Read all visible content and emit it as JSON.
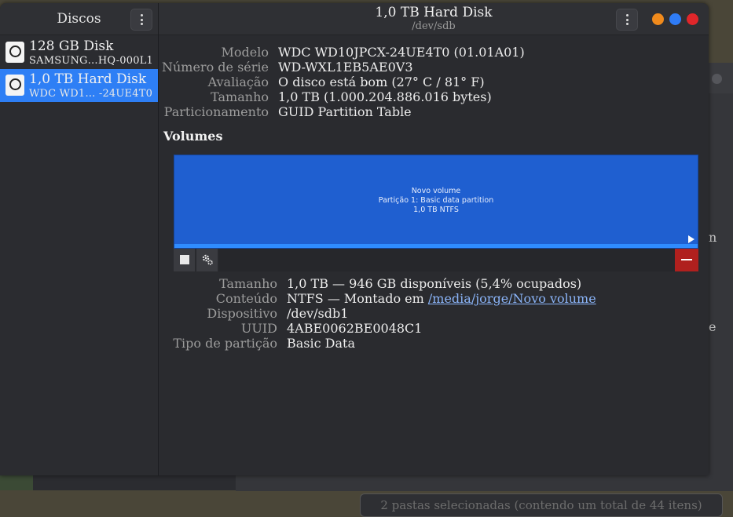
{
  "background": {
    "status_text": "2 pastas selecionadas (contendo um total de 44 itens)",
    "edge_chars": [
      "n",
      "e"
    ]
  },
  "sidebar": {
    "title": "Discos",
    "disks": [
      {
        "name": "128 GB Disk",
        "subtitle": "SAMSUNG…HQ-000L1",
        "selected": false
      },
      {
        "name": "1,0 TB Hard Disk",
        "subtitle": "WDC WD1…  -24UE4T0",
        "selected": true
      }
    ]
  },
  "window": {
    "title": "1,0 TB Hard Disk",
    "subtitle": "/dev/sdb",
    "controls": {
      "minimize_color": "#f08a1c",
      "maximize_color": "#2f7cf6",
      "close_color": "#e0262a"
    }
  },
  "drive_info": [
    {
      "label": "Modelo",
      "value": "WDC WD10JPCX-24UE4T0 (01.01A01)"
    },
    {
      "label": "Número de série",
      "value": "WD-WXL1EB5AE0V3"
    },
    {
      "label": "Avaliação",
      "value": "O disco está bom (27° C / 81° F)"
    },
    {
      "label": "Tamanho",
      "value": "1,0 TB (1.000.204.886.016 bytes)"
    },
    {
      "label": "Particionamento",
      "value": "GUID Partition Table"
    }
  ],
  "volumes": {
    "section_title": "Volumes",
    "map": {
      "line1": "Novo volume",
      "line2": "Partição 1: Basic data partition",
      "line3": "1,0 TB NTFS"
    }
  },
  "volume_info": [
    {
      "label": "Tamanho",
      "value": "1,0 TB — 946 GB disponíveis (5,4% ocupados)"
    },
    {
      "label": "Conteúdo",
      "value_prefix": "NTFS — Montado em ",
      "link": "/media/jorge/Novo volume"
    },
    {
      "label": "Dispositivo",
      "value": "/dev/sdb1"
    },
    {
      "label": "UUID",
      "value": "4ABE0062BE0048C1"
    },
    {
      "label": "Tipo de partição",
      "value": "Basic Data"
    }
  ]
}
